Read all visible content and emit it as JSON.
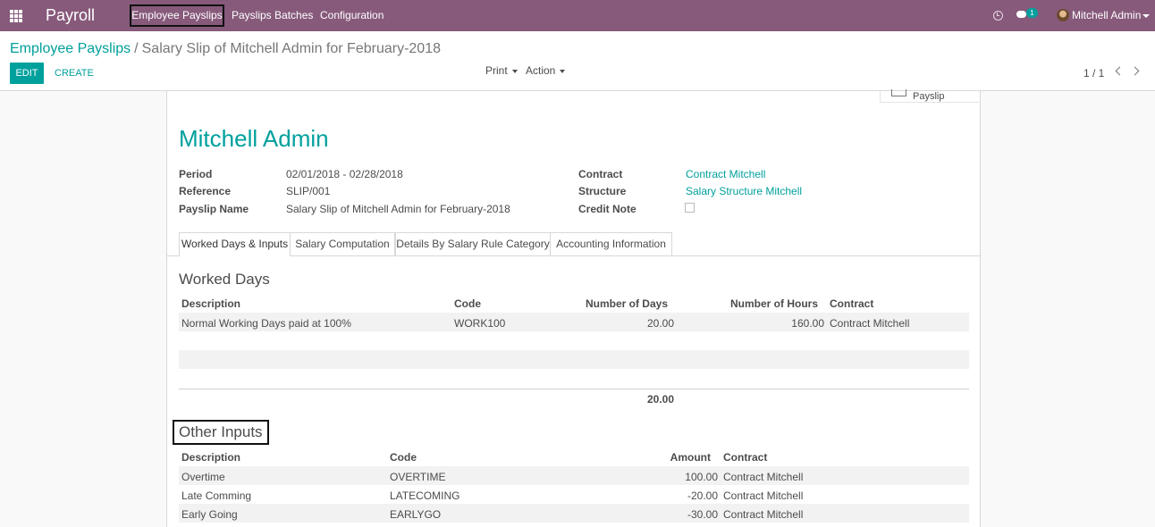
{
  "navbar": {
    "brand": "Payroll",
    "menu": [
      "Employee Payslips",
      "Payslips Batches",
      "Configuration"
    ],
    "chat_count": "1",
    "user": "Mitchell Admin"
  },
  "control_panel": {
    "breadcrumb_parent": "Employee Payslips",
    "breadcrumb_sep": "/",
    "breadcrumb_current": "Salary Slip of Mitchell Admin for February-2018",
    "edit_label": "EDIT",
    "create_label": "CREATE",
    "print_label": "Print",
    "action_label": "Action",
    "pager": "1 / 1"
  },
  "sheet": {
    "payslip_button_label": "Payslip",
    "employee_name": "Mitchell Admin",
    "fields_left": [
      {
        "label": "Period",
        "value": "02/01/2018 - 02/28/2018"
      },
      {
        "label": "Reference",
        "value": "SLIP/001"
      },
      {
        "label": "Payslip Name",
        "value": "Salary Slip of Mitchell Admin for February-2018"
      }
    ],
    "fields_right": [
      {
        "label": "Contract",
        "value": "Contract Mitchell"
      },
      {
        "label": "Structure",
        "value": "Salary Structure Mitchell"
      },
      {
        "label": "Credit Note",
        "value": ""
      }
    ],
    "tabs": [
      "Worked Days & Inputs",
      "Salary Computation",
      "Details By Salary Rule Category",
      "Accounting Information"
    ],
    "worked_days": {
      "title": "Worked Days",
      "headers": [
        "Description",
        "Code",
        "Number of Days",
        "Number of Hours",
        "Contract"
      ],
      "rows": [
        {
          "description": "Normal Working Days paid at 100%",
          "code": "WORK100",
          "days": "20.00",
          "hours": "160.00",
          "contract": "Contract Mitchell"
        }
      ],
      "total_days": "20.00"
    },
    "other_inputs": {
      "title": "Other Inputs",
      "headers": [
        "Description",
        "Code",
        "Amount",
        "Contract"
      ],
      "rows": [
        {
          "description": "Overtime",
          "code": "OVERTIME",
          "amount": "100.00",
          "contract": "Contract Mitchell"
        },
        {
          "description": "Late Comming",
          "code": "LATECOMING",
          "amount": "-20.00",
          "contract": "Contract Mitchell"
        },
        {
          "description": "Early Going",
          "code": "EARLYGO",
          "amount": "-30.00",
          "contract": "Contract Mitchell"
        }
      ]
    }
  },
  "colors": {
    "navbar": "#875a7b",
    "accent": "#00a09d"
  }
}
